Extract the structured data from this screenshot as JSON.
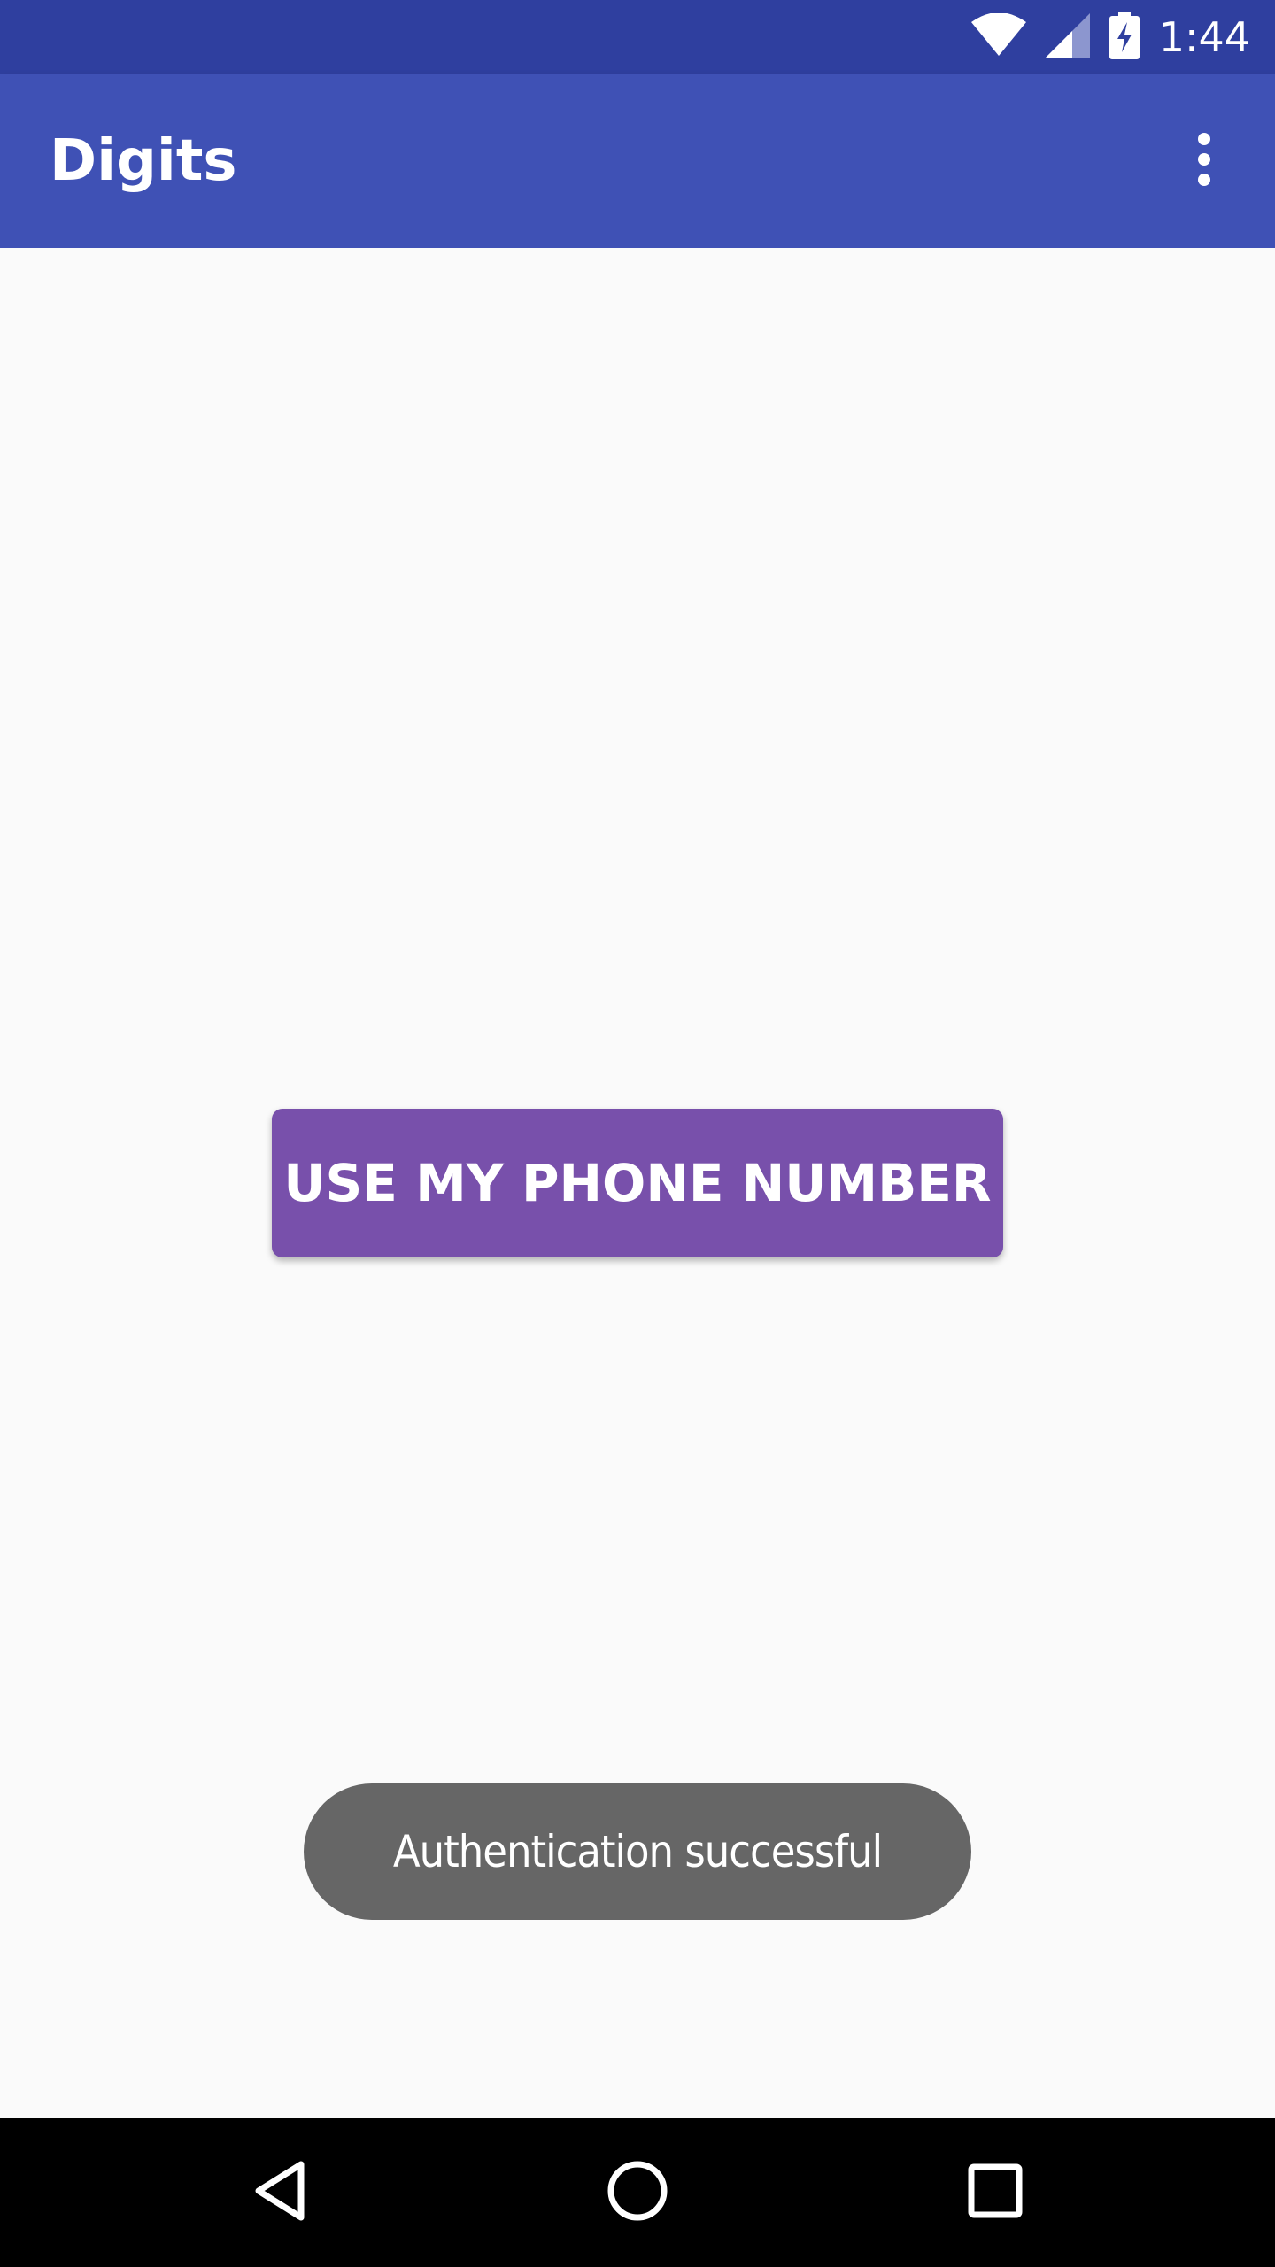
{
  "status_bar": {
    "time": "1:44",
    "icons": [
      "wifi-icon",
      "cell-signal-icon",
      "battery-charging-icon"
    ]
  },
  "app_bar": {
    "title": "Digits",
    "menu_icon": "overflow-menu-icon"
  },
  "main": {
    "button_label": "USE MY PHONE NUMBER"
  },
  "toast": {
    "message": "Authentication successful"
  },
  "nav_bar": {
    "icons": [
      "back-icon",
      "home-icon",
      "recents-icon"
    ]
  },
  "colors": {
    "status_bar": "#2f3f9f",
    "app_bar": "#3f51b5",
    "button": "#7850ab",
    "toast": "#666666",
    "background": "#fafafa",
    "nav_bar": "#000000"
  }
}
